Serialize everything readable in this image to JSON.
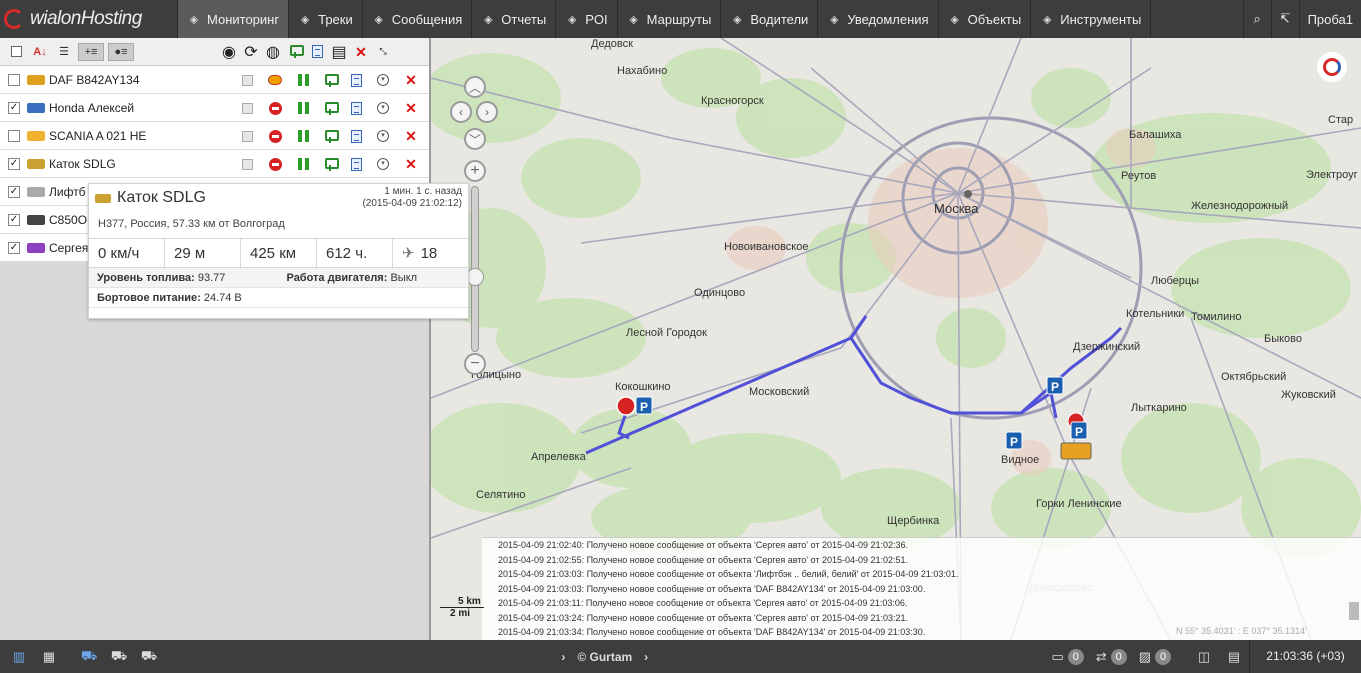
{
  "app": {
    "logo_main": "wialon",
    "logo_sub": "Hosting"
  },
  "nav": [
    {
      "label": "Мониторинг",
      "icon": "globe-icon",
      "active": true
    },
    {
      "label": "Треки",
      "icon": "track-icon",
      "active": false
    },
    {
      "label": "Сообщения",
      "icon": "messages-icon",
      "active": false
    },
    {
      "label": "Отчеты",
      "icon": "report-icon",
      "active": false
    },
    {
      "label": "POI",
      "icon": "poi-icon",
      "active": false
    },
    {
      "label": "Маршруты",
      "icon": "route-icon",
      "active": false
    },
    {
      "label": "Водители",
      "icon": "driver-icon",
      "active": false
    },
    {
      "label": "Уведомления",
      "icon": "notification-icon",
      "active": false
    },
    {
      "label": "Объекты",
      "icon": "objects-icon",
      "active": false
    },
    {
      "label": "Инструменты",
      "icon": "tools-icon",
      "active": false
    }
  ],
  "user": {
    "name": "Проба1"
  },
  "units": [
    {
      "name": "DAF B842AY134",
      "checked": false,
      "color": "#e0a020",
      "first_icon": "key"
    },
    {
      "name": "Honda Алексей",
      "checked": true,
      "color": "#3a6fc0",
      "first_icon": "stop"
    },
    {
      "name": "SCANIA A 021 HE",
      "checked": false,
      "color": "#f0b030",
      "first_icon": "stop"
    },
    {
      "name": "Каток SDLG",
      "checked": true,
      "color": "#caa030",
      "first_icon": "stop"
    },
    {
      "name": "Лифтб",
      "checked": true,
      "color": "#aaaaaa",
      "first_icon": "stop"
    },
    {
      "name": "C850O",
      "checked": true,
      "color": "#444444",
      "first_icon": "stop"
    },
    {
      "name": "Сергея",
      "checked": true,
      "color": "#8a3fc0",
      "first_icon": "stop"
    }
  ],
  "popup": {
    "title": "Каток SDLG",
    "time_ago": "1 мин. 1 с. назад",
    "timestamp": "(2015-04-09 21:02:12)",
    "address": "Н377, Россия, 57.33 км от Волгоград",
    "speed": "0 км/ч",
    "altitude": "29 м",
    "distance": "425 км",
    "hours": "612 ч.",
    "satellites": "18",
    "fuel_label": "Уровень топлива:",
    "fuel_value": "93.77",
    "engine_label": "Работа двигателя:",
    "engine_value": "Выкл",
    "power_label": "Бортовое питание:",
    "power_value": "24.74 В"
  },
  "map": {
    "labels": [
      "Дедовск",
      "Нахабино",
      "Красногорск",
      "Новоивановское",
      "Одинцово",
      "Лесной Городок",
      "Голицыно",
      "Кокошкино",
      "Апрелевка",
      "Селятино",
      "Московский",
      "Москва",
      "Видное",
      "Щербинка",
      "Горки Ленинские",
      "Балашиха",
      "Реутов",
      "Железнодорожный",
      "Люберцы",
      "Котельники",
      "Томилино",
      "Дзержинский",
      "Быково",
      "Октябрьский",
      "Лыткарино",
      "Жуковский",
      "Электроуг",
      "Стар",
      "Домодедово"
    ],
    "scale_km": "5 km",
    "scale_mi": "2 mi",
    "coords": "N 55° 35.4031' : E 037° 35.1314'"
  },
  "log": [
    "2015-04-09 21:02:40: Получено новое сообщение от объекта 'Сергея авто' от 2015-04-09 21:02:36.",
    "2015-04-09 21:02:55: Получено новое сообщение от объекта 'Сергея авто' от 2015-04-09 21:02:51.",
    "2015-04-09 21:03:03: Получено новое сообщение от объекта 'Лифтбэк .. белий, белий' от 2015-04-09 21:03:01.",
    "2015-04-09 21:03:03: Получено новое сообщение от объекта 'DAF B842AY134' от 2015-04-09 21:03:00.",
    "2015-04-09 21:03:11: Получено новое сообщение от объекта 'Сергея авто' от 2015-04-09 21:03:06.",
    "2015-04-09 21:03:24: Получено новое сообщение от объекта 'Сергея авто' от 2015-04-09 21:03:21.",
    "2015-04-09 21:03:34: Получено новое сообщение от объекта 'DAF B842AY134' от 2015-04-09 21:03:30."
  ],
  "bottom": {
    "copyright": "© Gurtam",
    "badge1": "0",
    "badge2": "0",
    "badge3": "0",
    "clock": "21:03:36 (+03)"
  }
}
